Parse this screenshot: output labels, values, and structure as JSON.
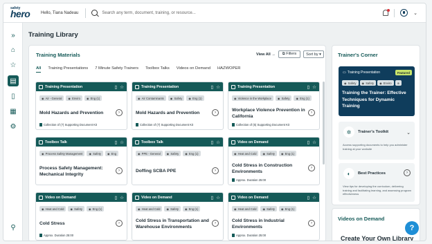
{
  "header": {
    "logo_small": "safety",
    "logo_main": "hero",
    "greeting": "Hello, Tiana Nadeau",
    "search_placeholder": "Search any term, document, training, or resource..."
  },
  "page_title": "Training Library",
  "materials": {
    "title": "Training Materials",
    "view_all": "View All →",
    "filters_label": "⧉ Filters",
    "sort_label": "Sort by ▾",
    "tabs": [
      "All",
      "Training Presentations",
      "7 Minute Safety Trainers",
      "Toolbox Talks",
      "Videos on Demand",
      "HAZWOPER"
    ],
    "cards": [
      {
        "type": "Training Presentation",
        "tags": [
          "Air - General",
          "Enviro",
          "Eng (1)"
        ],
        "title": "Mold Hazards and Prevention",
        "foot": "Collection of (7) Supporting Document Kit"
      },
      {
        "type": "Training Presentation",
        "tags": [
          "Air Contaminants",
          "Safety",
          "Eng (1)"
        ],
        "title": "Mold Hazards and Prevention",
        "foot": "Collection of (7) Supporting Document Kit"
      },
      {
        "type": "Training Presentation",
        "tags": [
          "Violence in the Workplace",
          "Safety",
          "Eng (1)"
        ],
        "title": "Workplace Violence Prevention in California",
        "foot": "Collection of (5) Supporting Document Kit"
      },
      {
        "type": "Toolbox Talk",
        "tags": [
          "Process Safety Management",
          "Safety",
          "Eng"
        ],
        "title": "Process Safety Management: Mechanical Integrity",
        "foot": ""
      },
      {
        "type": "Toolbox Talk",
        "tags": [
          "PPE - General",
          "Safety",
          "Eng (1)"
        ],
        "title": "Doffing SCBA PPE",
        "foot": ""
      },
      {
        "type": "Video on Demand",
        "tags": [
          "Heat and Cold",
          "Safety",
          "Eng (1)"
        ],
        "title": "Cold Stress in Construction Environments",
        "foot": "Approx. Duration 25:00"
      },
      {
        "type": "Video on Demand",
        "tags": [
          "Heat and Cold",
          "Safety",
          "Eng (1)"
        ],
        "title": "Cold Stress",
        "foot": "Approx. Duration 25:00"
      },
      {
        "type": "Video on Demand",
        "tags": [
          "Heat and Cold",
          "Safety",
          "Eng (1)"
        ],
        "title": "Cold Stress in Transportation and Warehouse Environments",
        "foot": ""
      },
      {
        "type": "Video on Demand",
        "tags": [
          "Heat and Cold",
          "Safety",
          "Eng (1)"
        ],
        "title": "Cold Stress in Industrial Environments",
        "foot": "Approx. Duration 25:00"
      }
    ]
  },
  "corner": {
    "title": "Trainer's Corner",
    "featured": {
      "type": "Training Presentation",
      "badge": "Featured",
      "tags": [
        "Safety",
        "Safety",
        "Enviro"
      ],
      "title": "Training the Trainer: Effective Techniques for Dynamic Training"
    },
    "toolkit": {
      "title": "Trainer's Toolkit",
      "desc": "Access supporting documents to help you administer training at your worksite"
    },
    "best": {
      "title": "Best Practices",
      "desc": "View tips for developing the curriculum, delivering training and facilitating learning, and assessing program effectiveness"
    }
  },
  "vod": {
    "title": "Videos on Demand",
    "subtitle": "Create Your Own Library"
  },
  "colors": {
    "primary": "#155a58",
    "navy": "#0f3d5c",
    "accent": "#c7e46b",
    "help": "#1f8fd6"
  }
}
